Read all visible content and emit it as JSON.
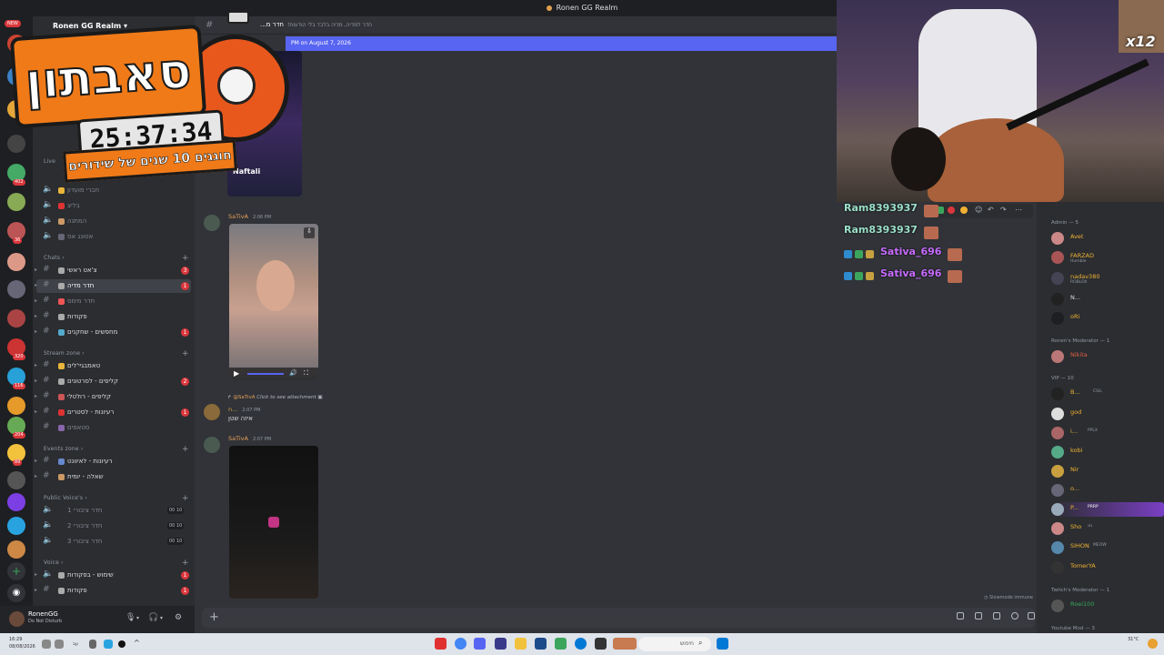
{
  "window": {
    "title": "Ronen GG Realm"
  },
  "server": {
    "name": "Ronen GG Realm",
    "badge_new": "NEW"
  },
  "server_badges": [
    "402",
    "36",
    "320",
    "116",
    "204",
    "89"
  ],
  "channels": {
    "live_label": "Live",
    "top_items": [
      {
        "name": "חברי מועדון",
        "type": "voice"
      },
      {
        "name": "בליצ",
        "type": "voice"
      },
      {
        "name": "המתנה",
        "type": "voice"
      },
      {
        "name": "אטונג אס",
        "type": "voice"
      }
    ],
    "chats_label": "Chats",
    "chats": [
      {
        "name": "צ'אט ראשי",
        "badge": "3"
      },
      {
        "name": "חדר מדיה",
        "badge": "1",
        "selected": true
      },
      {
        "name": "חדר מימס",
        "badge": ""
      },
      {
        "name": "פקודות",
        "badge": ""
      },
      {
        "name": "מחפשים - שחקנים",
        "badge": "1"
      }
    ],
    "stream_label": "Stream zone",
    "stream": [
      {
        "name": "טאמבגיי'לים",
        "badge": ""
      },
      {
        "name": "קליפים - לסרטונים",
        "badge": "2"
      },
      {
        "name": "קליפים - רולטלי",
        "badge": ""
      },
      {
        "name": "רעיונות - לסטרים",
        "badge": "1"
      },
      {
        "name": "סטאפים",
        "badge": ""
      }
    ],
    "events_label": "Events zone",
    "events": [
      {
        "name": "רעיונות - לאיוונט",
        "badge": ""
      },
      {
        "name": "שאלה - יומית",
        "badge": ""
      }
    ],
    "public_label": "Public Voice's",
    "public": [
      {
        "name": "חדר ציבורי 1",
        "count": "00 10"
      },
      {
        "name": "חדר ציבורי 2",
        "count": "00 10"
      },
      {
        "name": "חדר ציבורי 3",
        "count": "00 10"
      }
    ],
    "voice_label": "Voice",
    "voice": [
      {
        "name": "שימוש - בפקודות",
        "badge": "1"
      },
      {
        "name": "פקודות",
        "badge": "1"
      }
    ]
  },
  "user": {
    "name": "RonenGG",
    "status": "Do Not Disturb"
  },
  "chat": {
    "channel_title": "חדר מ...",
    "channel_desc": "חדר למדיה, מדיה בלבד בלי הודעות!",
    "new_since": "PM on August 7, 2026",
    "messages": [
      {
        "author": "SaTivA",
        "time": "2:06 PM"
      },
      {
        "reply_to": "@SaTivA",
        "reply_text": "Click to see attachment",
        "author": "n...",
        "time": "2:07 PM",
        "text": "איזה שטן"
      },
      {
        "author": "SaTivA",
        "time": "2:07 PM"
      }
    ],
    "video_label": "Naftali",
    "slowmode": "Slowmode immune"
  },
  "members": {
    "groups": [
      {
        "label": "Admin — 5",
        "items": [
          {
            "name": "Avet",
            "color": "#f0b232",
            "sub": ""
          },
          {
            "name": "FARZAD",
            "color": "#f0b232",
            "sub": "Humble"
          },
          {
            "name": "nadav380",
            "color": "#f0b232",
            "sub": "ROBLOX"
          },
          {
            "name": "N...",
            "color": "#dbdee1",
            "sub": ""
          },
          {
            "name": "oRi",
            "color": "#f0b232",
            "sub": ""
          }
        ]
      },
      {
        "label": "Ronen's Moderator — 1",
        "items": [
          {
            "name": "Nikita",
            "color": "#e06040",
            "sub": ""
          }
        ]
      },
      {
        "label": "VIP — 10",
        "items": [
          {
            "name": "B...",
            "color": "#f0b232",
            "sub": "CSIL"
          },
          {
            "name": "god",
            "color": "#f0b232",
            "sub": ""
          },
          {
            "name": "i...",
            "color": "#f0b232",
            "sub": "PPLX"
          },
          {
            "name": "kobi",
            "color": "#f0b232",
            "sub": ""
          },
          {
            "name": "Nir",
            "color": "#f0b232",
            "sub": ""
          },
          {
            "name": "o...",
            "color": "#f0b232",
            "sub": ""
          },
          {
            "name": "P...",
            "color": "#f0b232",
            "sub": "PRRP"
          },
          {
            "name": "Sho",
            "color": "#f0b232",
            "sub": "גזג"
          },
          {
            "name": "SIHON",
            "color": "#f0b232",
            "sub": "MEOW"
          },
          {
            "name": "TomerYA",
            "color": "#f0b232",
            "sub": ""
          }
        ]
      },
      {
        "label": "Twitch's Moderator — 1",
        "items": [
          {
            "name": "Roei100",
            "color": "#3ba55c",
            "sub": ""
          }
        ]
      },
      {
        "label": "Youtube Mod — 3",
        "items": []
      }
    ]
  },
  "overlay": {
    "chat_lines": [
      {
        "name": "Ram8393937",
        "color": "#9be0c8"
      },
      {
        "name": "Ram8393937",
        "color": "#9be0c8"
      },
      {
        "name": "Sativa_696",
        "color": "#c76cff"
      },
      {
        "name": "Sativa_696",
        "color": "#c76cff"
      }
    ],
    "timer_title": "סאבתון",
    "timer_value": "25:37:34",
    "timer_sub": "חוגגים 10 שנים של שידורים",
    "cam_badge": "x12"
  },
  "taskbar": {
    "time": "16:29",
    "date": "08/08/2026",
    "search": "חיפוש",
    "lang": "עב",
    "weather": "31°C"
  },
  "colors": {
    "accent": "#5865f2",
    "danger": "#da373c",
    "author": "#e8a15a"
  }
}
